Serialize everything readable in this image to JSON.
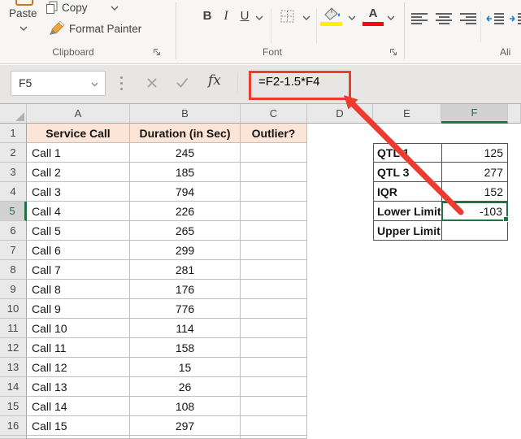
{
  "ribbon": {
    "paste_label": "Paste",
    "copy_label": "Copy",
    "format_painter_label": "Format Painter",
    "clipboard_group_label": "Clipboard",
    "font_group_label": "Font",
    "alignment_group_label": "Ali",
    "bold_label": "B",
    "italic_label": "I",
    "underline_label": "U"
  },
  "formula_bar": {
    "name_box_value": "F5",
    "fx_label": "fx",
    "formula": "=F2-1.5*F4"
  },
  "grid": {
    "column_headers": [
      "A",
      "B",
      "C",
      "D",
      "E",
      "F"
    ],
    "selected_column": "F",
    "selected_row": 5,
    "selected_cell": "F5",
    "row_numbers": [
      1,
      2,
      3,
      4,
      5,
      6,
      7,
      8,
      9,
      10,
      11,
      12,
      13,
      14,
      15,
      16
    ],
    "main_table": {
      "headers": [
        "Service Call",
        "Duration (in Sec)",
        "Outlier?"
      ],
      "rows": [
        [
          "Call 1",
          "245"
        ],
        [
          "Call 2",
          "185"
        ],
        [
          "Call 3",
          "794"
        ],
        [
          "Call 4",
          "226"
        ],
        [
          "Call 5",
          "265"
        ],
        [
          "Call 6",
          "299"
        ],
        [
          "Call 7",
          "281"
        ],
        [
          "Call 8",
          "176"
        ],
        [
          "Call 9",
          "776"
        ],
        [
          "Call 10",
          "114"
        ],
        [
          "Call 11",
          "158"
        ],
        [
          "Call 12",
          "15"
        ],
        [
          "Call 13",
          "26"
        ],
        [
          "Call 14",
          "108"
        ],
        [
          "Call 15",
          "297"
        ]
      ]
    },
    "stats_table": {
      "rows": [
        [
          "QTL 1",
          "125"
        ],
        [
          "QTL 3",
          "277"
        ],
        [
          "IQR",
          "152"
        ],
        [
          "Lower Limit",
          "-103"
        ],
        [
          "Upper Limit",
          ""
        ]
      ]
    }
  },
  "colors": {
    "selection_green": "#217346",
    "annotation_red": "#EC3B2F",
    "header_row_fill": "#FCE4D6",
    "highlight_yellow": "#FFF000",
    "font_color_red": "#F50B0B"
  }
}
